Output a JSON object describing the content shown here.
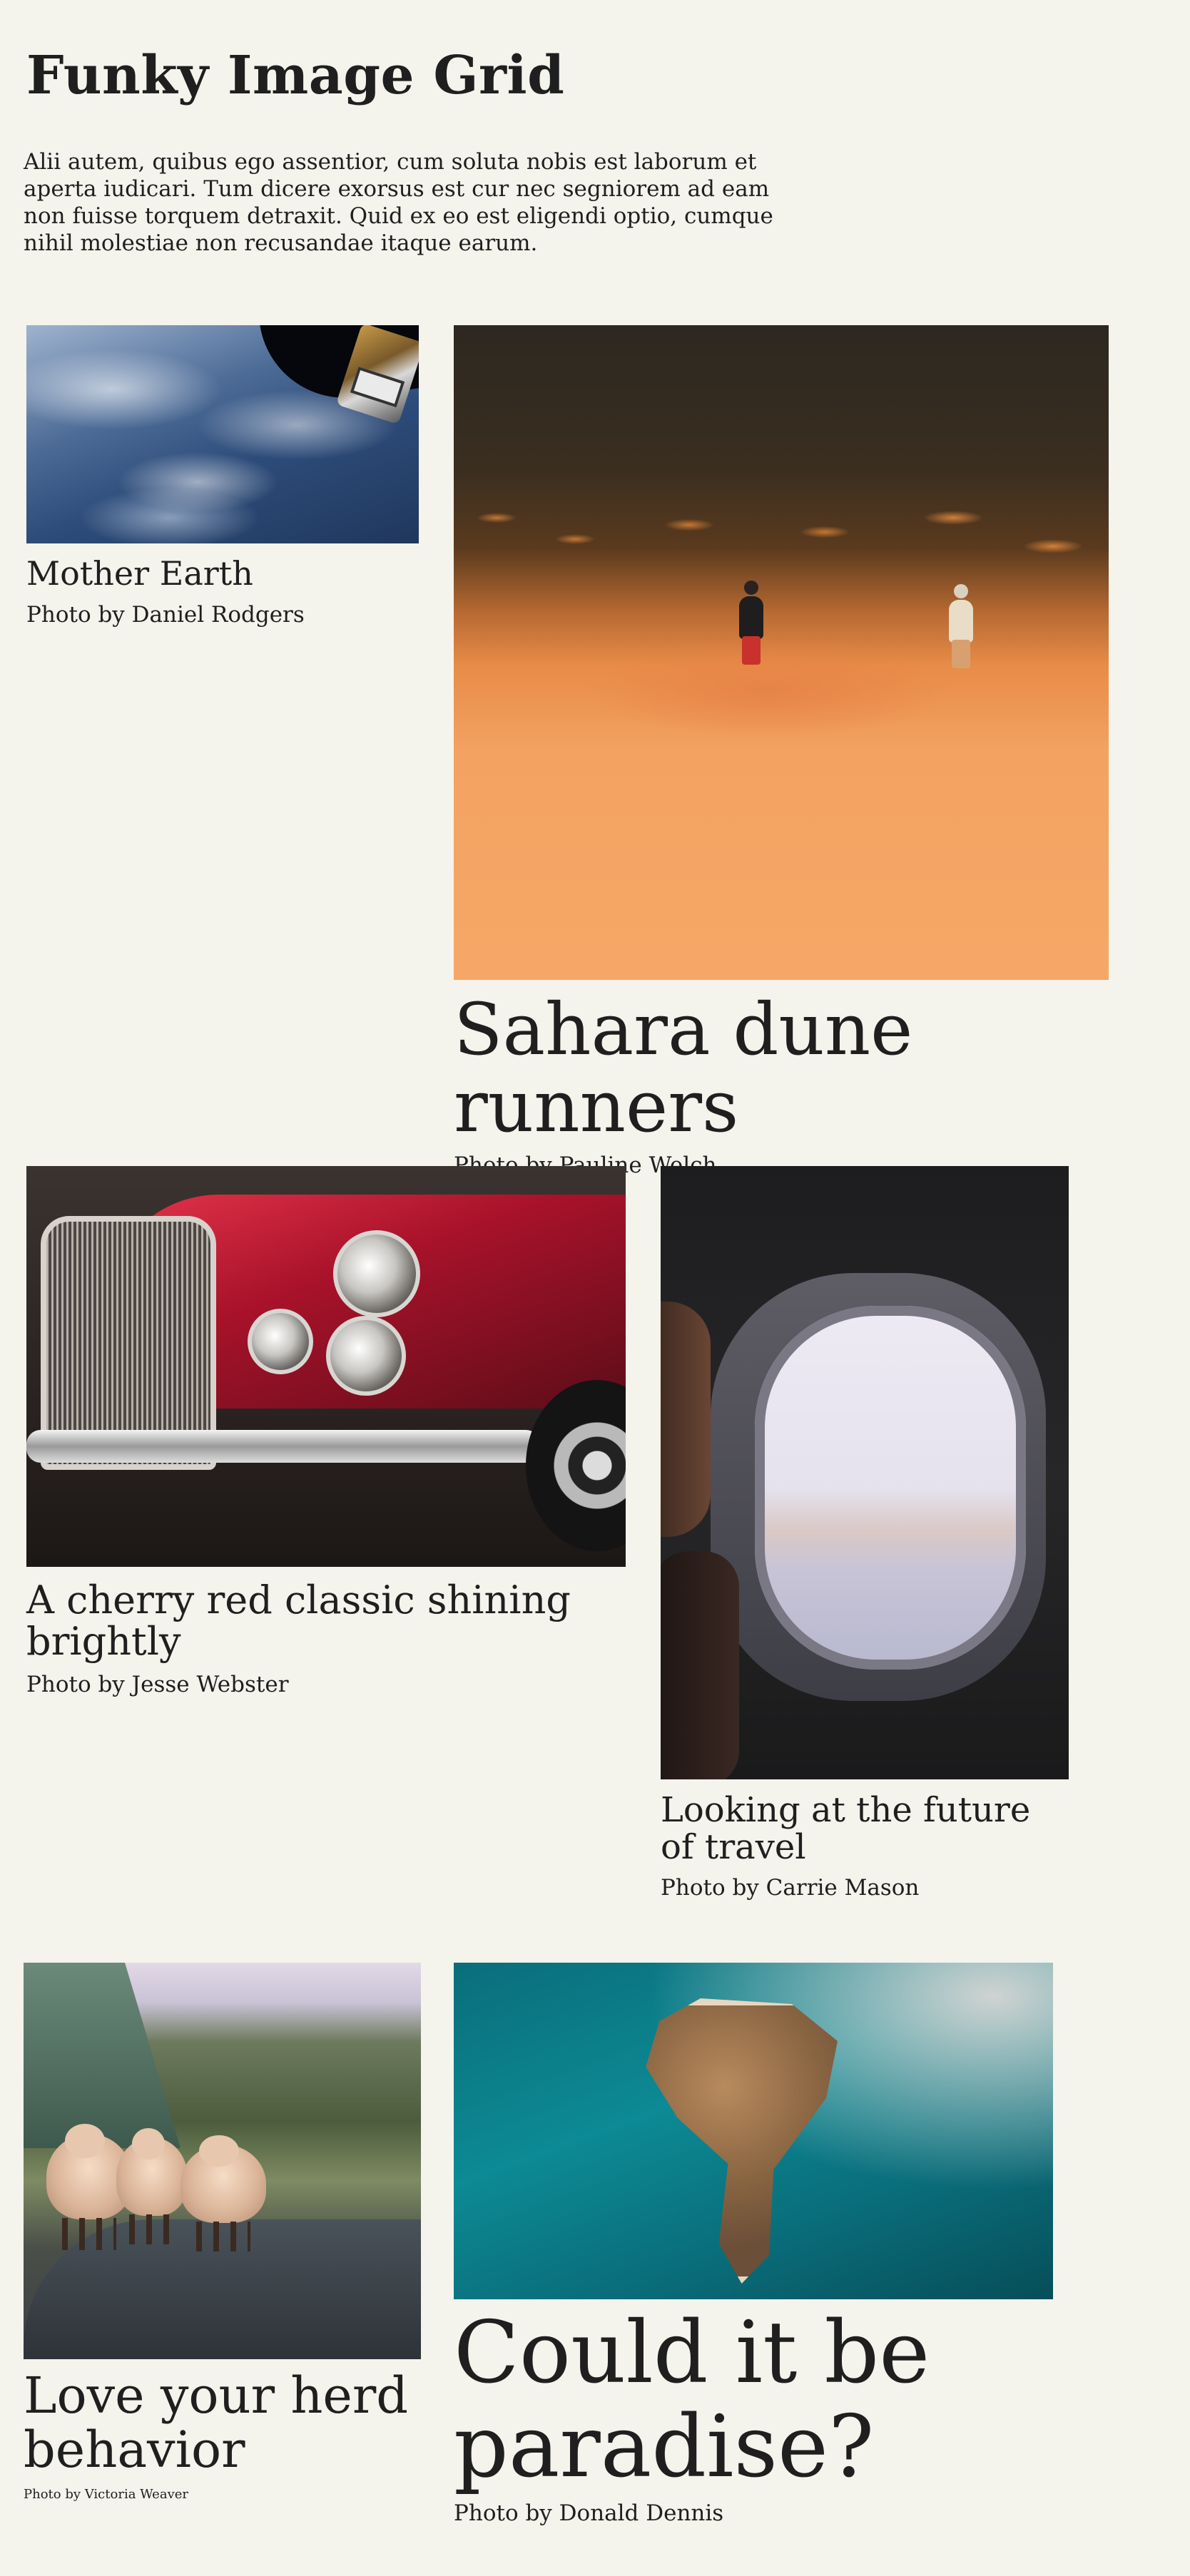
{
  "page": {
    "title": "Funky Image Grid",
    "intro": "Alii autem, quibus ego assentior, cum soluta nobis est laborum et aperta iudicari. Tum dicere exorsus est cur nec segniorem ad eam non fuisse torquem detraxit. Quid ex eo est eligendi optio, cumque nihil molestiae non recusandae itaque earum."
  },
  "cards": [
    {
      "title": "Mother Earth",
      "credit": "Photo by Daniel Rodgers"
    },
    {
      "title": "Sahara dune runners",
      "credit": "Photo by Pauline Welch"
    },
    {
      "title": "A cherry red classic shining brightly",
      "credit": "Photo by Jesse Webster"
    },
    {
      "title": "Looking at the future of travel",
      "credit": "Photo by Carrie Mason"
    },
    {
      "title": "Love your herd behavior",
      "credit": "Photo by Victoria Weaver"
    },
    {
      "title": "Could it be paradise?",
      "credit": "Photo by Donald Dennis"
    }
  ]
}
